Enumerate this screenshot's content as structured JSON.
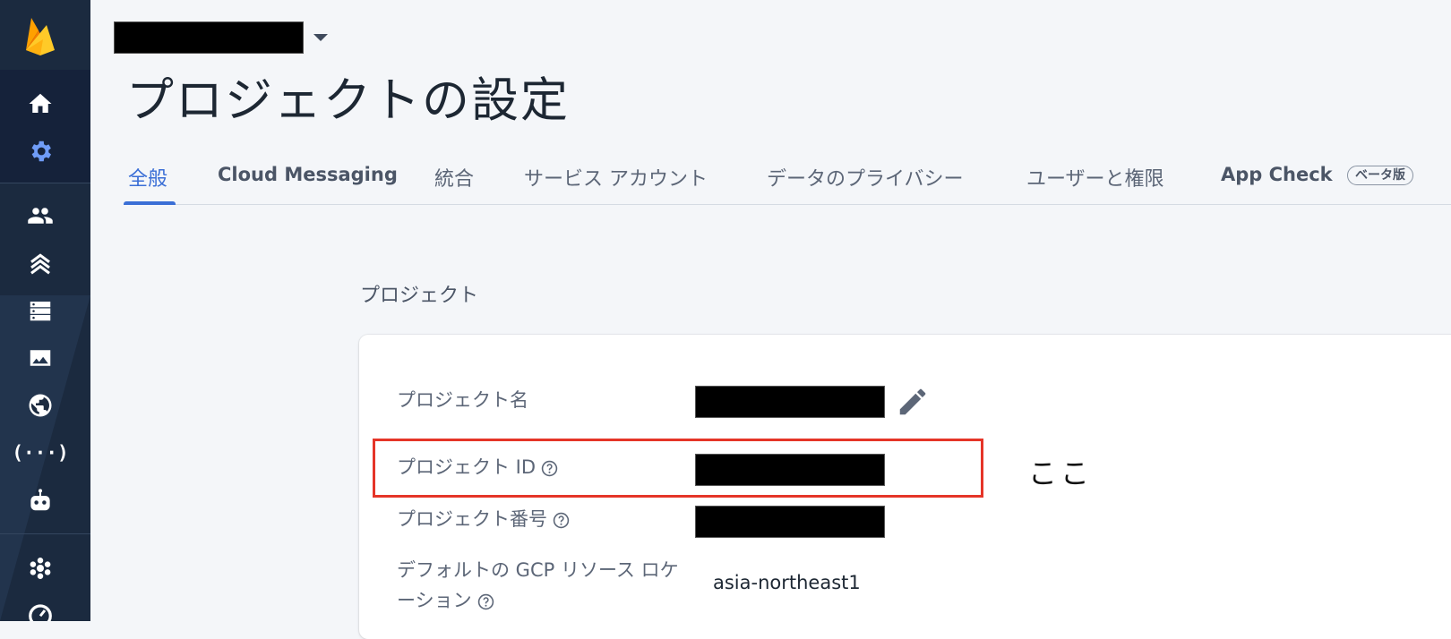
{
  "header": {
    "page_title": "プロジェクトの設定"
  },
  "tabs": [
    {
      "label": "全般",
      "active": true
    },
    {
      "label": "Cloud Messaging"
    },
    {
      "label": "統合"
    },
    {
      "label": "サービス アカウント"
    },
    {
      "label": "データのプライバシー"
    },
    {
      "label": "ユーザーと権限"
    },
    {
      "label": "App Check",
      "badge": "ベータ版"
    }
  ],
  "section": {
    "title": "プロジェクト"
  },
  "fields": {
    "project_name_label": "プロジェクト名",
    "project_id_label": "プロジェクト ID",
    "project_number_label": "プロジェクト番号",
    "gcp_location_label_line1": "デフォルトの GCP リソース ロケ",
    "gcp_location_label_line2": "ーション",
    "gcp_location_value": "asia-northeast1"
  },
  "annotation": {
    "text": "ここ",
    "highlight_color": "#e53528"
  },
  "sidebar": {
    "icons": [
      "firebase-logo",
      "home-icon",
      "settings-icon",
      "users-icon",
      "extensions-icon",
      "database-icon",
      "storage-image-icon",
      "hosting-globe-icon",
      "functions-icon",
      "ml-robot-icon",
      "crashlytics-icon",
      "performance-icon"
    ]
  },
  "colors": {
    "accent": "#3b6fd6",
    "sidebar_bg": "#1b2a3f"
  }
}
